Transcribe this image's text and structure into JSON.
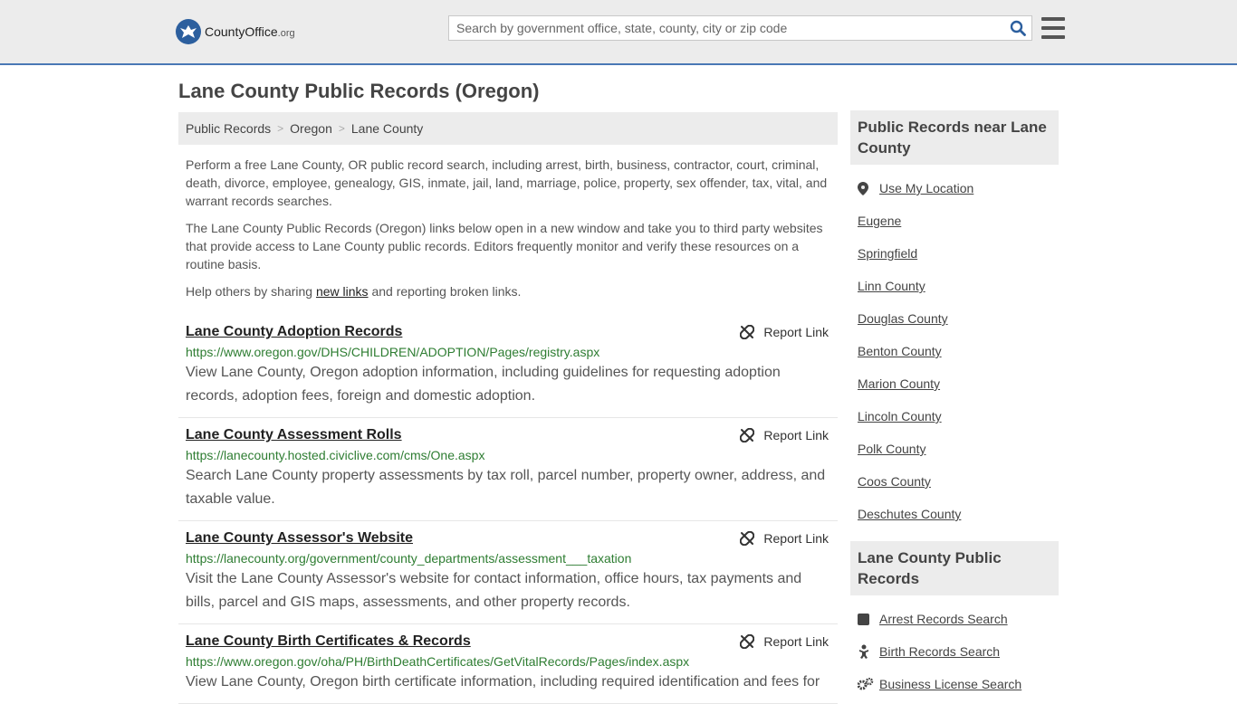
{
  "header": {
    "logo_main": "CountyOffice",
    "logo_suffix": ".org",
    "search_placeholder": "Search by government office, state, county, city or zip code",
    "search_icon": "search-icon",
    "menu_icon": "hamburger-menu-icon"
  },
  "page": {
    "title": "Lane County Public Records (Oregon)"
  },
  "breadcrumb": [
    "Public Records",
    "Oregon",
    "Lane County"
  ],
  "intro": {
    "p1": "Perform a free Lane County, OR public record search, including arrest, birth, business, contractor, court, criminal, death, divorce, employee, genealogy, GIS, inmate, jail, land, marriage, police, property, sex offender, tax, vital, and warrant records searches.",
    "p2": "The Lane County Public Records (Oregon) links below open in a new window and take you to third party websites that provide access to Lane County public records. Editors frequently monitor and verify these resources on a routine basis.",
    "p3_before": "Help others by sharing ",
    "p3_link": "new links",
    "p3_after": " and reporting broken links."
  },
  "report_label": "Report Link",
  "records": [
    {
      "title": "Lane County Adoption Records",
      "url": "https://www.oregon.gov/DHS/CHILDREN/ADOPTION/Pages/registry.aspx",
      "desc": "View Lane County, Oregon adoption information, including guidelines for requesting adoption records, adoption fees, foreign and domestic adoption."
    },
    {
      "title": "Lane County Assessment Rolls",
      "url": "https://lanecounty.hosted.civiclive.com/cms/One.aspx",
      "desc": "Search Lane County property assessments by tax roll, parcel number, property owner, address, and taxable value."
    },
    {
      "title": "Lane County Assessor's Website",
      "url": "https://lanecounty.org/government/county_departments/assessment___taxation",
      "desc": "Visit the Lane County Assessor's website for contact information, office hours, tax payments and bills, parcel and GIS maps, assessments, and other property records."
    },
    {
      "title": "Lane County Birth Certificates & Records",
      "url": "https://www.oregon.gov/oha/PH/BirthDeathCertificates/GetVitalRecords/Pages/index.aspx",
      "desc": "View Lane County, Oregon birth certificate information, including required identification and fees for"
    }
  ],
  "sidebar": {
    "near_heading": "Public Records near Lane County",
    "use_location": "Use My Location",
    "near_items": [
      "Eugene",
      "Springfield",
      "Linn County",
      "Douglas County",
      "Benton County",
      "Marion County",
      "Lincoln County",
      "Polk County",
      "Coos County",
      "Deschutes County"
    ],
    "records_heading": "Lane County Public Records",
    "record_items": [
      {
        "label": "Arrest Records Search",
        "icon": "square-icon"
      },
      {
        "label": "Birth Records Search",
        "icon": "baby-icon"
      },
      {
        "label": "Business License Search",
        "icon": "gears-icon"
      }
    ]
  }
}
